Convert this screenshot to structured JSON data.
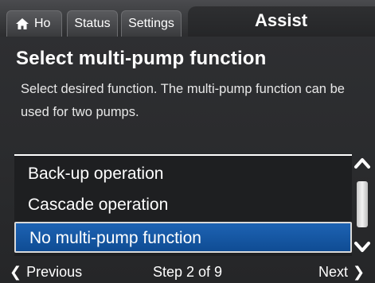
{
  "tabs": {
    "home": "Ho",
    "status": "Status",
    "settings": "Settings",
    "active": "Assist"
  },
  "title": "Select multi-pump function",
  "description": "Select desired function. The multi-pump function can be used for two pumps.",
  "options": [
    "Back-up operation",
    "Cascade operation",
    "No multi-pump function"
  ],
  "selected_option": "No multi-pump function",
  "footer": {
    "previous": "Previous",
    "step": "Step 2 of 9",
    "next": "Next"
  },
  "icons": {
    "home": "home-icon",
    "previous": "chevron-left-icon",
    "next": "chevron-right-icon",
    "scroll_up": "chevron-up-icon",
    "scroll_down": "chevron-down-icon"
  },
  "colors": {
    "selected_background": "#1a5aa6",
    "background": "#2b2c2e"
  }
}
